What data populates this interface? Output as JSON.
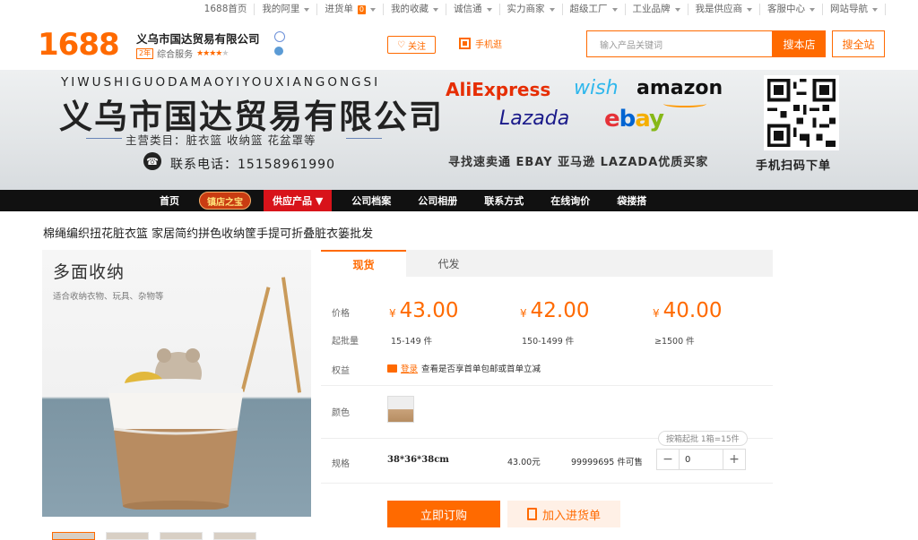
{
  "topnav": {
    "items": [
      "1688首页",
      "我的阿里",
      "进货单",
      "我的收藏",
      "诚信通",
      "实力商家",
      "超级工厂",
      "工业品牌",
      "我是供应商",
      "客服中心",
      "网站导航"
    ],
    "cart_count": "0"
  },
  "header": {
    "logo": "1688",
    "company": "义乌市国达贸易有限公司",
    "years_badge": "2年",
    "service_label": "综合服务",
    "rating_stars": 4,
    "follow_label": "关注",
    "mobile_label": "手机逛",
    "search_placeholder": "输入产品关键词",
    "search_shop_label": "搜本店",
    "search_all_label": "搜全站"
  },
  "banner": {
    "pinyin": "YIWUSHIGUODAMAOYIYOUXIANGONGSI",
    "title": "义乌市国达贸易有限公司",
    "category": "主营类目：脏衣篮 收纳篮 花盆罩等",
    "phone": "联系电话：15158961990",
    "brands": {
      "ali": "AliExpress",
      "wish": "wish",
      "amazon": "amazon",
      "lazada": "Lazada",
      "ebay_e": "e",
      "ebay_b": "b",
      "ebay_a": "a",
      "ebay_y": "y"
    },
    "slogan": "寻找速卖通 EBAY 亚马逊 LAZADA优质买家",
    "qr_text": "手机扫码下单"
  },
  "mainnav": {
    "items": [
      "首页",
      "镇店之宝",
      "供应产品 ▼",
      "公司档案",
      "公司相册",
      "联系方式",
      "在线询价",
      "袋搂搭"
    ]
  },
  "product": {
    "title": "棉绳编织扭花脏衣篮 家居简约拼色收纳筐手提可折叠脏衣篓批发",
    "gallery_headline": "多面收纳",
    "gallery_sub": "适合收纳衣物、玩具、杂物等"
  },
  "purchase": {
    "tabs": [
      "现货",
      "代发"
    ],
    "price_label": "价格",
    "moq_label": "起批量",
    "currency": "¥",
    "prices": [
      "43.00",
      "42.00",
      "40.00"
    ],
    "tiers": [
      "15-149 件",
      "150-1499 件",
      "≥1500 件"
    ],
    "benefit_label": "权益",
    "benefit_link": "登录",
    "benefit_text": "查看是否享首单包邮或首单立减",
    "color_label": "颜色",
    "spec_label": "规格",
    "box_hint": "按箱起批 1箱=15件",
    "spec_name": "38*36*38cm",
    "spec_price": "43.00元",
    "spec_stock": "99999695 件可售",
    "qty_minus": "−",
    "qty_value": "0",
    "qty_plus": "+",
    "order_label": "立即订购",
    "cart_label": "加入进货单"
  }
}
